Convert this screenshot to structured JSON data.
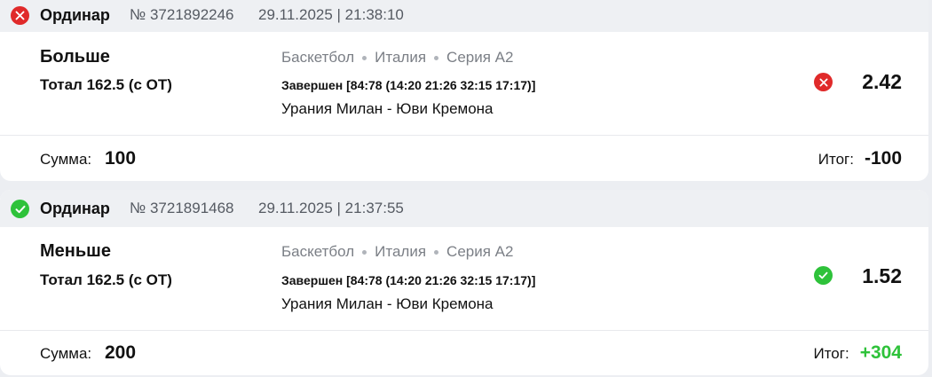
{
  "bets": [
    {
      "status": "lost",
      "type": "Ординар",
      "number": "№ 3721892246",
      "date": "29.11.2025 | 21:38:10",
      "pick": "Больше",
      "market": "Тотал 162.5 (с ОТ)",
      "sport": "Баскетбол",
      "country": "Италия",
      "league": "Серия А2",
      "event_status": "Завершен [84:78 (14:20 21:26 32:15 17:17)]",
      "teams": "Урания Милан - Юви Кремона",
      "odds": "2.42",
      "sum_label": "Сумма:",
      "sum": "100",
      "total_label": "Итог:",
      "total": "-100",
      "status_icon": "close-icon",
      "status_color": "#e02a2a"
    },
    {
      "status": "won",
      "type": "Ординар",
      "number": "№ 3721891468",
      "date": "29.11.2025 | 21:37:55",
      "pick": "Меньше",
      "market": "Тотал 162.5 (с ОТ)",
      "sport": "Баскетбол",
      "country": "Италия",
      "league": "Серия А2",
      "event_status": "Завершен [84:78 (14:20 21:26 32:15 17:17)]",
      "teams": "Урания Милан - Юви Кремона",
      "odds": "1.52",
      "sum_label": "Сумма:",
      "sum": "200",
      "total_label": "Итог:",
      "total": "+304",
      "status_icon": "check-icon",
      "status_color": "#2ec23a"
    }
  ]
}
